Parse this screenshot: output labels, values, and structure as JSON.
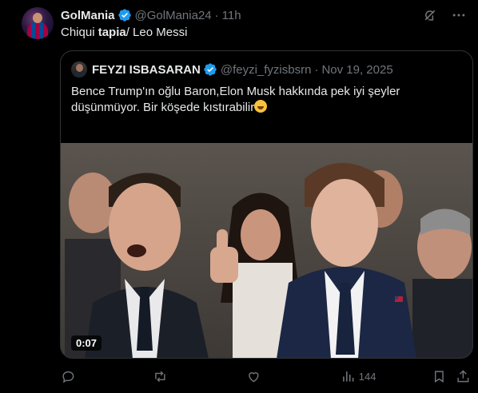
{
  "tweet": {
    "author_name": "GolMania",
    "author_handle": "@GolMania24",
    "separator": "·",
    "time": "11h",
    "text_before": "Chiqui ",
    "text_bold": "tapia",
    "text_after": "/ Leo Messi"
  },
  "quoted": {
    "author_name": "FEYZI ISBASARAN",
    "author_handle": "@feyzi_fyzisbsrn",
    "separator": "·",
    "date": "Nov 19, 2025",
    "text": "Bence Trump'ın oğlu Baron,Elon Musk hakkında pek iyi şeyler düşünmüyor. Bir köşede kıstırabilir",
    "emoji": "laughing-tears-emoji",
    "video_duration": "0:07"
  },
  "actions": {
    "reply_count": "",
    "retweet_count": "",
    "like_count": "",
    "views_count": "144"
  },
  "icons": {
    "top": [
      "grok-icon",
      "more-icon"
    ],
    "actions": [
      "reply-icon",
      "retweet-icon",
      "like-icon",
      "views-icon",
      "bookmark-icon",
      "share-icon"
    ]
  },
  "colors": {
    "background": "#000000",
    "text": "#e7e9ea",
    "muted": "#71767b",
    "verified": "#1d9bf0",
    "border": "#2f3336"
  }
}
